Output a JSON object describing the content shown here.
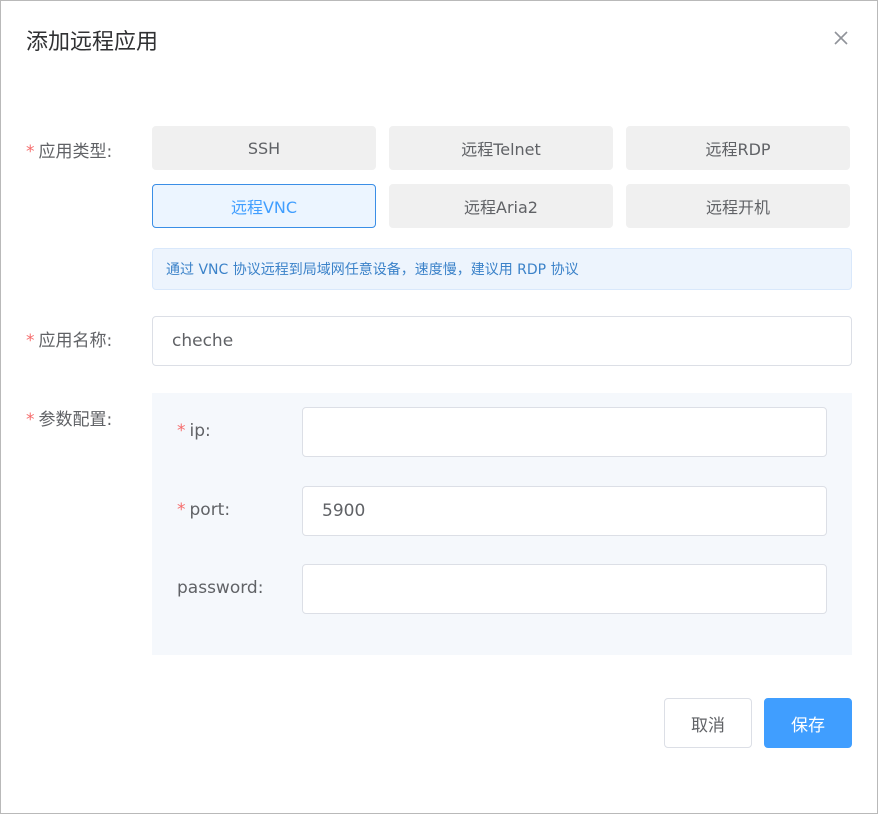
{
  "dialog": {
    "title": "添加远程应用"
  },
  "form": {
    "app_type": {
      "label": "应用类型:",
      "options": [
        "SSH",
        "远程Telnet",
        "远程RDP",
        "远程VNC",
        "远程Aria2",
        "远程开机"
      ],
      "selected": "远程VNC",
      "hint": "通过 VNC 协议远程到局域网任意设备，速度慢，建议用 RDP 协议"
    },
    "app_name": {
      "label": "应用名称:",
      "value": "cheche"
    },
    "params": {
      "label": "参数配置:",
      "ip": {
        "label": "ip:",
        "value": ""
      },
      "port": {
        "label": "port:",
        "value": "5900"
      },
      "password": {
        "label": "password:",
        "value": ""
      }
    }
  },
  "footer": {
    "cancel_label": "取消",
    "save_label": "保存"
  },
  "colors": {
    "primary": "#409eff",
    "required_star": "#f56c6c"
  },
  "icons": {
    "close": "close-icon"
  }
}
